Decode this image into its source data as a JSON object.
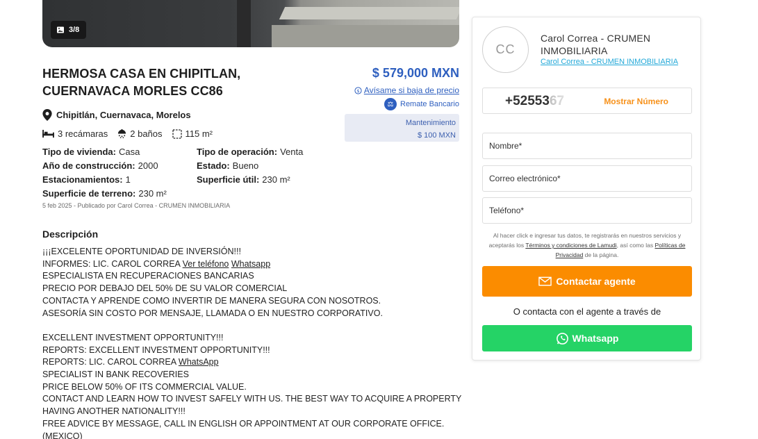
{
  "gallery": {
    "counter": "3/8",
    "icon": "image-icon"
  },
  "listing": {
    "title_line1": "HERMOSA CASA EN CHIPITLAN,",
    "title_line2": "CUERNAVACA MORLES CC86",
    "price": "$ 579,000 MXN",
    "price_alert": "Avísame si baja de precio",
    "remate": "Remate Bancario",
    "maintenance_label": "Mantenimiento",
    "maintenance_value": "$ 100 MXN",
    "location": "Chipitlán, Cuernavaca, Morelos",
    "features": {
      "bedrooms": "3 recámaras",
      "bathrooms": "2 baños",
      "area": "115 m²"
    },
    "specs": [
      {
        "label": "Tipo de vivienda:",
        "value": "Casa"
      },
      {
        "label": "Tipo de operación:",
        "value": "Venta"
      },
      {
        "label": "Año de construcción:",
        "value": "2000"
      },
      {
        "label": "Estado:",
        "value": "Bueno"
      },
      {
        "label": "Estacionamientos:",
        "value": "1"
      },
      {
        "label": "Superficie útil:",
        "value": "230 m²"
      },
      {
        "label": "Superficie de terreno:",
        "value": "230 m²"
      }
    ],
    "published": "5 feb 2025 - Publicado por Carol Correa - CRUMEN INMOBILIARIA"
  },
  "description": {
    "heading": "Descripción",
    "line1": "¡¡¡EXCELENTE OPORTUNIDAD DE INVERSIÓN!!!",
    "line2_prefix": "INFORMES: LIC. CAROL CORREA ",
    "line2_link1": "Ver teléfono",
    "line2_link2": "Whatsapp",
    "line3": "ESPECIALISTA EN RECUPERACIONES BANCARIAS",
    "line4": "PRECIO POR DEBAJO DEL 50% DE SU VALOR COMERCIAL",
    "line5": "CONTACTA Y APRENDE COMO INVERTIR DE MANERA SEGURA CON NOSOTROS.",
    "line6": "ASESORÍA SIN COSTO POR MENSAJE, LLAMADA O EN NUESTRO CORPORATIVO.",
    "line7": "EXCELLENT INVESTMENT OPPORTUNITY!!!",
    "line8": "REPORTS: EXCELLENT INVESTMENT OPPORTUNITY!!!",
    "line9_prefix": "REPORTS: LIC. CAROL CORREA ",
    "line9_link": "WhatsApp",
    "line10": "SPECIALIST IN BANK RECOVERIES",
    "line11": "PRICE BELOW 50% OF ITS COMMERCIAL VALUE.",
    "line12": "CONTACT AND LEARN HOW TO INVEST SAFELY WITH US. THE BEST WAY TO ACQUIRE A PROPERTY",
    "line13": "HAVING ANOTHER NATIONALITY!!!",
    "line14": "FREE ADVICE BY MESSAGE, CALL IN ENGLISH OR APPOINTMENT AT OUR CORPORATE OFFICE.",
    "line15": "(MEXICO)"
  },
  "agent": {
    "initials": "CC",
    "name": "Carol Correa - CRUMEN INMOBILIARIA",
    "link": "Carol Correa - CRUMEN INMOBILIARIA",
    "phone_visible": "+52553",
    "phone_faded": "67",
    "show_number": "Mostrar Número"
  },
  "form": {
    "name_placeholder": "Nombre*",
    "email_placeholder": "Correo electrónico*",
    "phone_placeholder": "Teléfono*",
    "legal_part1": "Al hacer click e ingresar tus datos, te registrarás en nuestros servicios y aceptarás los ",
    "legal_link1": "Términos y condiciones de Lamudi",
    "legal_part2": ", así como las ",
    "legal_link2": "Políticas de Privacidad",
    "legal_part3": " de la página.",
    "cta": "Contactar agente",
    "or_text": "O contacta con el agente a través de",
    "whatsapp": "Whatsapp"
  },
  "colors": {
    "price_blue": "#2e5fbf",
    "cta_orange": "#fb8c00",
    "whatsapp_green": "#25d366",
    "link_cyan": "#22a8d8"
  }
}
